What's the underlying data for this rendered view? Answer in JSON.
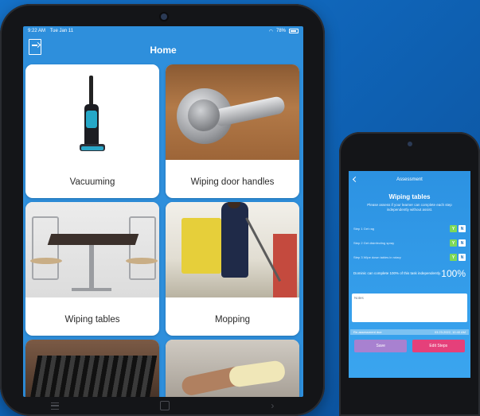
{
  "tablet": {
    "status": {
      "time": "9:22 AM",
      "date": "Tue Jan 11",
      "battery": "78%"
    },
    "title": "Home",
    "cards": [
      {
        "label": "Vacuuming"
      },
      {
        "label": "Wiping door handles"
      },
      {
        "label": "Wiping tables"
      },
      {
        "label": "Mopping"
      },
      {
        "label": ""
      },
      {
        "label": ""
      }
    ],
    "bottom_nav": {
      "back": "›"
    }
  },
  "phone": {
    "header": "Assessment",
    "title": "Wiping tables",
    "subtitle": "Please assess if your learner can complete each step independently without assist.",
    "steps": [
      {
        "label": "Step 1  Get rag",
        "yes": "Y",
        "no": "N"
      },
      {
        "label": "Step 2  Get disinfecting spray",
        "yes": "Y",
        "no": "N"
      },
      {
        "label": "Step 3  Wipe down tables in rotary",
        "yes": "Y",
        "no": "N"
      }
    ],
    "summary": "Dominic can complete 100% of this task independently.",
    "percent": "100%",
    "notes_label": "Notes",
    "due_label": "Re-assessment due",
    "due_value": "03.23.2022, 10:40 AM",
    "save_label": "Save",
    "edit_label": "Edit Steps"
  },
  "colors": {
    "background": "#1572c9",
    "screen_blue": "#2e8fdc",
    "save_button": "#a881d0",
    "edit_button": "#e5407a",
    "yes_active": "#7ed957"
  },
  "icons": [
    "exit-icon",
    "wifi-icon",
    "battery-icon",
    "back-chevron-icon",
    "menu-icon",
    "home-icon"
  ]
}
